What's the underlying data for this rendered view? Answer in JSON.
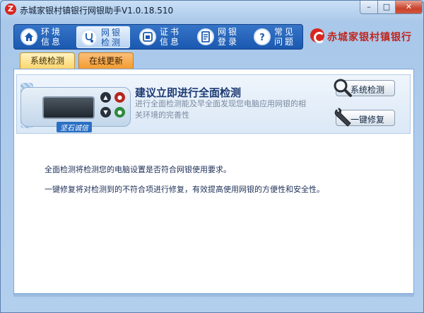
{
  "window": {
    "title": "赤城家银村镇银行网银助手V1.0.18.510",
    "app_icon": "Z",
    "min_glyph": "–",
    "max_glyph": "□",
    "close_glyph": "✕"
  },
  "nav": {
    "items": [
      {
        "label": "环境信息",
        "icon": "home-icon"
      },
      {
        "label": "网银检测",
        "icon": "stethoscope-icon",
        "active": true
      },
      {
        "label": "证书信息",
        "icon": "certificate-icon"
      },
      {
        "label": "网银登录",
        "icon": "document-icon"
      },
      {
        "label": "常见问题",
        "icon": "question-icon"
      }
    ]
  },
  "logo": {
    "text": "赤城家银村镇银行"
  },
  "tabs": {
    "check": "系统检测",
    "update": "在线更新"
  },
  "check": {
    "title": "建议立即进行全面检测",
    "description": "进行全面检测能及早全面发现您电脑应用网银的相关环境的完善性",
    "device_label": "坚石诚信"
  },
  "buttons": {
    "scan": "系统检测",
    "repair": "一键修复"
  },
  "info": {
    "line1": "全面检测将检测您的电脑设置是否符合网银使用要求。",
    "line2": "一键修复将对检测到的不符合项进行修复，有效提高使用网银的方便性和安全性。"
  },
  "colors": {
    "accent": "#1a59b0",
    "brand": "#c0241c",
    "tab_active": "#fcd36b",
    "tab_inactive": "#f09a2d"
  }
}
